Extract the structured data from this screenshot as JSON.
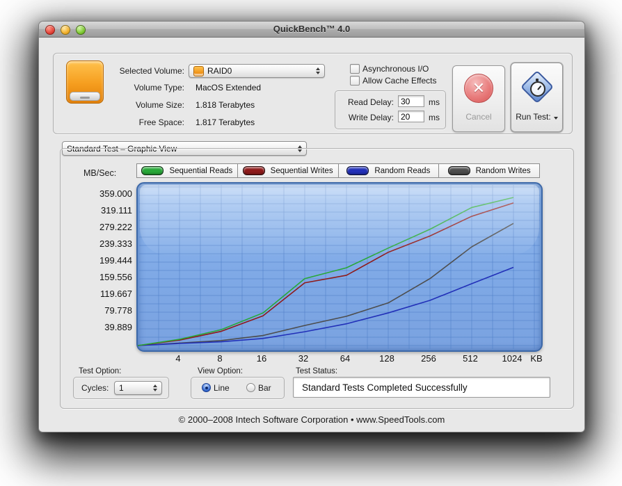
{
  "window": {
    "title": "QuickBench™ 4.0",
    "footer": "© 2000–2008 Intech Software Corporation • www.SpeedTools.com"
  },
  "volume_panel": {
    "selected_volume_label": "Selected Volume:",
    "selected_volume_value": "RAID0",
    "volume_type_label": "Volume Type:",
    "volume_type_value": "MacOS Extended",
    "volume_size_label": "Volume Size:",
    "volume_size_value": "1.818 Terabytes",
    "free_space_label": "Free Space:",
    "free_space_value": "1.817 Terabytes",
    "async_io_label": "Asynchronous I/O",
    "cache_effects_label": "Allow Cache Effects",
    "read_delay_label": "Read Delay:",
    "read_delay_value": "30",
    "read_delay_unit": "ms",
    "write_delay_label": "Write Delay:",
    "write_delay_value": "20",
    "write_delay_unit": "ms",
    "cancel_label": "Cancel",
    "cancel_icon": "✕",
    "run_test_label": "Run Test:"
  },
  "test_view": {
    "mode_value": "Standard Test – Graphic View",
    "y_axis_title": "MB/Sec:"
  },
  "bottom": {
    "test_option_label": "Test Option:",
    "cycles_label": "Cycles:",
    "cycles_value": "1",
    "view_option_label": "View Option:",
    "line_label": "Line",
    "bar_label": "Bar",
    "test_status_label": "Test Status:",
    "test_status_value": "Standard Tests Completed Successfully"
  },
  "chart_data": {
    "type": "line",
    "title": "Standard Test – Graphic View",
    "ylabel": "MB/Sec:",
    "x_unit": "KB",
    "x_labels": [
      "4",
      "8",
      "16",
      "32",
      "64",
      "128",
      "256",
      "512",
      "1024"
    ],
    "y_tick_labels": [
      "359.000",
      "319.111",
      "279.222",
      "239.333",
      "199.444",
      "159.556",
      "119.667",
      "79.778",
      "39.889"
    ],
    "ylim": [
      0,
      387
    ],
    "grid": true,
    "legend_position": "top",
    "series": [
      {
        "name": "Sequential Reads",
        "color": "#28a838",
        "values": [
          15,
          38,
          78,
          160,
          186,
          233,
          278,
          330,
          354
        ]
      },
      {
        "name": "Sequential Writes",
        "color": "#8e1a1a",
        "values": [
          13,
          34,
          71,
          150,
          168,
          223,
          262,
          309,
          341
        ]
      },
      {
        "name": "Random Reads",
        "color": "#2230b8",
        "values": [
          5,
          9,
          17,
          33,
          52,
          78,
          108,
          148,
          187
        ]
      },
      {
        "name": "Random Writes",
        "color": "#4d4d4d",
        "values": [
          6,
          12,
          24,
          48,
          70,
          102,
          160,
          236,
          292
        ]
      }
    ]
  }
}
